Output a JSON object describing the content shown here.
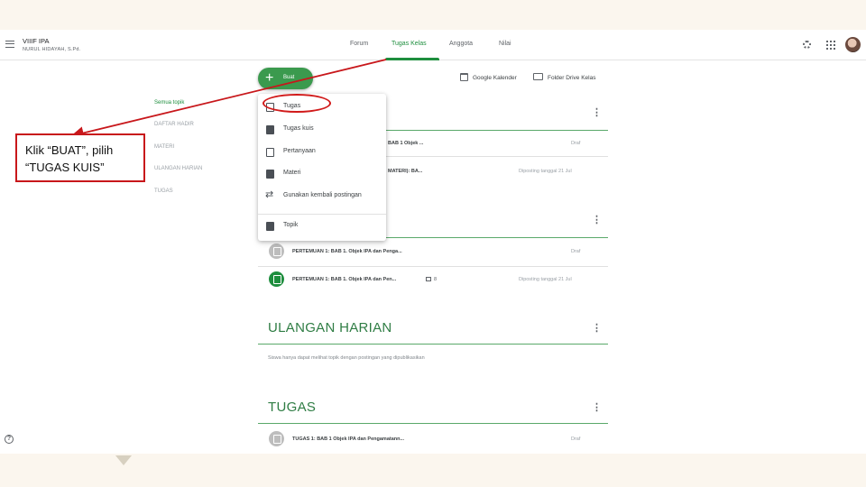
{
  "header": {
    "class_title": "VIIIF IPA",
    "teacher": "NURUL HIDAYAH, S.Pd.",
    "tabs": [
      {
        "label": "Forum",
        "active": false
      },
      {
        "label": "Tugas Kelas",
        "active": true
      },
      {
        "label": "Anggota",
        "active": false
      },
      {
        "label": "Nilai",
        "active": false
      }
    ],
    "icons": [
      "settings-gear-icon",
      "apps-grid-icon",
      "user-avatar"
    ]
  },
  "create_button": {
    "label": "Buat",
    "icon": "plus-icon"
  },
  "links": {
    "calendar": "Google Kalender",
    "drive": "Folder Drive Kelas"
  },
  "topics": [
    {
      "label": "Semua topik",
      "active": true
    },
    {
      "label": "DAFTAR HADIR",
      "active": false
    },
    {
      "label": "MATERI",
      "active": false
    },
    {
      "label": "ULANGAN HARIAN",
      "active": false
    },
    {
      "label": "TUGAS",
      "active": false
    }
  ],
  "create_menu": {
    "items": [
      {
        "label": "Tugas",
        "icon": "assignment-icon"
      },
      {
        "label": "Tugas kuis",
        "icon": "quiz-assignment-icon"
      },
      {
        "label": "Pertanyaan",
        "icon": "question-icon"
      },
      {
        "label": "Materi",
        "icon": "material-icon"
      },
      {
        "label": "Gunakan kembali postingan",
        "icon": "reuse-icon"
      },
      {
        "label": "Topik",
        "icon": "topic-icon"
      }
    ]
  },
  "stream": {
    "rows": [
      {
        "title": "BAB 1 Objek ...",
        "status": "Draf"
      },
      {
        "title": "MATERI): BA...",
        "status": "Diposting tanggal 21 Jul"
      },
      {
        "title": "PERTEMUAN 1: BAB 1. Objek IPA dan Penga...",
        "status": "Draf"
      },
      {
        "title": "PERTEMUAN 1: BAB 1. Objek IPA dan Pen...",
        "comments": "8",
        "status": "Diposting tanggal 21 Jul"
      }
    ],
    "ulangan": {
      "title": "ULANGAN HARIAN",
      "note": "Siswa hanya dapat melihat topik dengan postingan yang dipublikasikan"
    },
    "tugas": {
      "title": "TUGAS",
      "row": {
        "title": "TUGAS 1: BAB 1 Objek IPA dan Pengamatann...",
        "status": "Draf"
      }
    }
  },
  "callout": {
    "line1": "Klik “BUAT”, pilih",
    "line2": "“TUGAS KUIS”"
  },
  "colors": {
    "accent_green": "#1e8e3e",
    "annotation_red": "#c8171b",
    "slide_background": "#fbf6ee"
  }
}
